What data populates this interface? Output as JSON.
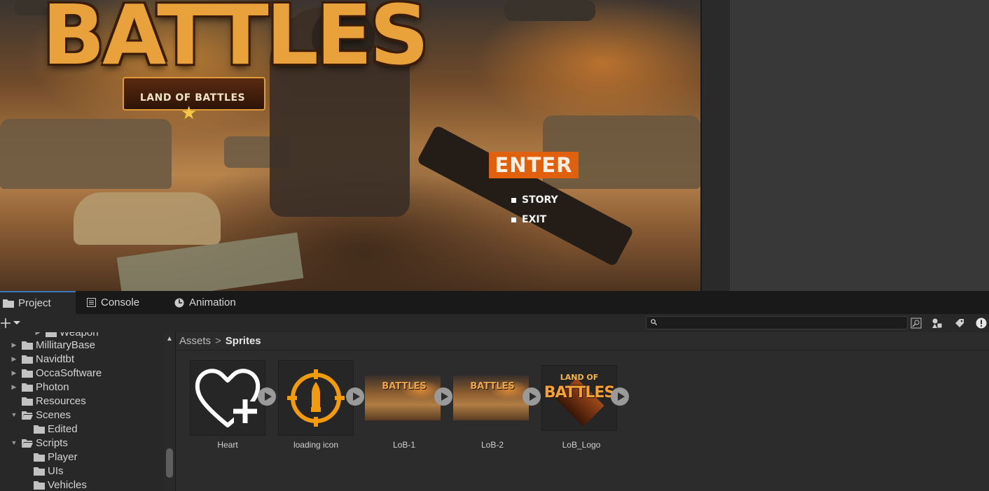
{
  "game": {
    "logo": {
      "title": "BATTLES",
      "subtitle": "LAND OF BATTLES"
    },
    "menu": {
      "enter": "ENTER",
      "story": "STORY",
      "exit": "EXIT"
    },
    "colors": {
      "enter_bg": "#e0600e"
    }
  },
  "tabs": [
    {
      "label": "Project",
      "icon": "folder-icon",
      "active": true
    },
    {
      "label": "Console",
      "icon": "console-icon",
      "active": false
    },
    {
      "label": "Animation",
      "icon": "animation-icon",
      "active": false
    }
  ],
  "toolbar": {
    "create_icon": "plus-icon",
    "search_placeholder": ""
  },
  "tree": {
    "items": [
      {
        "label": "Weapon",
        "expanded": false
      },
      {
        "label": "MillitaryBase",
        "expanded": false
      },
      {
        "label": "Navidtbt",
        "expanded": false
      },
      {
        "label": "OccaSoftware",
        "expanded": false
      },
      {
        "label": "Photon",
        "expanded": false
      },
      {
        "label": "Resources",
        "expanded": null
      },
      {
        "label": "Scenes",
        "expanded": true
      },
      {
        "label": "Edited",
        "expanded": null
      },
      {
        "label": "Scripts",
        "expanded": true
      },
      {
        "label": "Player",
        "expanded": null
      },
      {
        "label": "UIs",
        "expanded": null
      },
      {
        "label": "Vehicles",
        "expanded": null
      }
    ]
  },
  "breadcrumb": {
    "root": "Assets",
    "separator": ">",
    "current": "Sprites"
  },
  "assets": [
    {
      "name": "Heart",
      "icon": "heart-plus-icon"
    },
    {
      "name": "loading icon",
      "icon": "crosshair-bullet-icon"
    },
    {
      "name": "LoB-1",
      "thumb_title": "BATTLES"
    },
    {
      "name": "LoB-2",
      "thumb_title": "BATTLES"
    },
    {
      "name": "LoB_Logo",
      "thumb_title": "BATTLES",
      "thumb_subtitle": "LAND OF"
    }
  ],
  "colors": {
    "editor_bg": "#282828",
    "tab_accent": "#3a79bb",
    "asset_accent": "#f29b0e"
  }
}
